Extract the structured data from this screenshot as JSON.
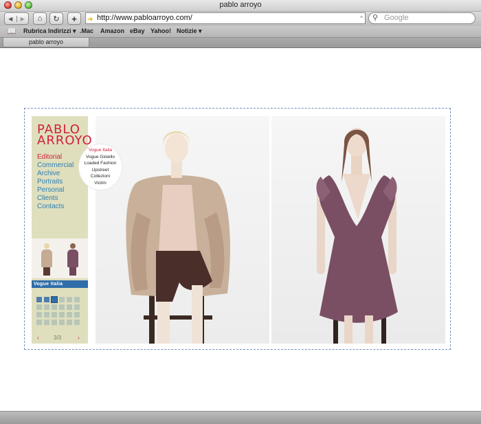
{
  "window": {
    "title": "pablo arroyo"
  },
  "toolbar": {
    "url": "http://www.pabloarroyo.com/",
    "search_placeholder": "Google",
    "back_glyph": "◀",
    "forward_glyph": "▶",
    "home_glyph": "⌂",
    "reload_glyph": "↻",
    "add_glyph": "+"
  },
  "bookmarks": [
    {
      "label": "Rubrica Indirizzi ▾"
    },
    {
      "label": ".Mac"
    },
    {
      "label": "Amazon"
    },
    {
      "label": "eBay"
    },
    {
      "label": "Yahoo!"
    },
    {
      "label": "Notizie ▾"
    }
  ],
  "tab": {
    "label": "pablo arroyo"
  },
  "site": {
    "logo_line1": "PABLO",
    "logo_line2": "ARROYO",
    "menu": [
      {
        "label": "Editorial",
        "active": true
      },
      {
        "label": "Commercial"
      },
      {
        "label": "Archive"
      },
      {
        "label": "Portraits"
      },
      {
        "label": "Personal"
      },
      {
        "label": "Clients"
      },
      {
        "label": "Contacts"
      }
    ],
    "gallery_label": "Vogue Italia",
    "pager": {
      "prev": "‹",
      "count": "3/3",
      "next": "›"
    },
    "editorial_submenu": [
      {
        "label": "Vogue Italia",
        "active": true
      },
      {
        "label": "Vogue Gioiello"
      },
      {
        "label": "Loaded Fashion"
      },
      {
        "label": "Upstreet"
      },
      {
        "label": "Collezioni"
      },
      {
        "label": "Victim"
      }
    ]
  },
  "colors": {
    "accent_red": "#d21f3c",
    "menu_blue": "#2e7fb4",
    "sidebar_bg": "#dfdfbe",
    "label_blue": "#2f6ea8"
  }
}
